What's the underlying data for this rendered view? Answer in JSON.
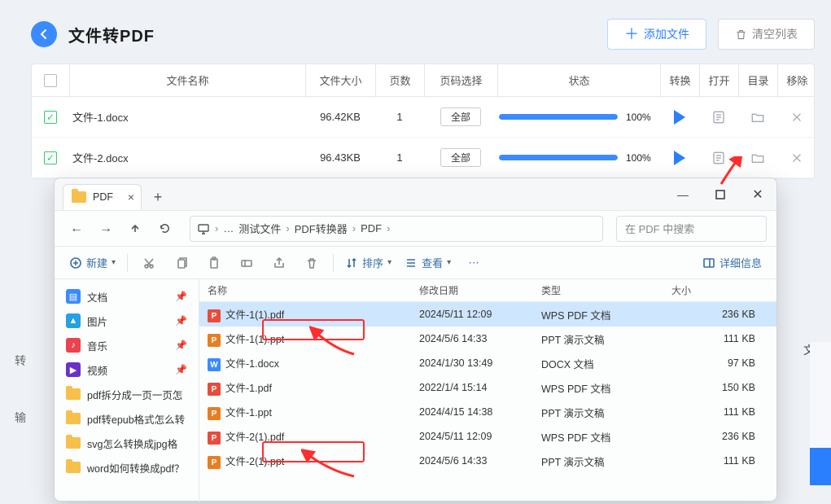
{
  "app": {
    "title": "文件转PDF",
    "add_btn": "添加文件",
    "clear_btn": "清空列表",
    "columns": {
      "name": "文件名称",
      "size": "文件大小",
      "pages": "页数",
      "page_sel": "页码选择",
      "status": "状态",
      "convert": "转换",
      "open": "打开",
      "dir": "目录",
      "remove": "移除"
    },
    "rows": [
      {
        "name": "文件-1.docx",
        "size": "96.42KB",
        "pages": "1",
        "page_sel": "全部",
        "pct": "100%",
        "progress": 100
      },
      {
        "name": "文件-2.docx",
        "size": "96.43KB",
        "pages": "1",
        "page_sel": "全部",
        "pct": "100%",
        "progress": 100
      }
    ]
  },
  "side_labels": {
    "col1": "文件",
    "col2": "转",
    "col3": "输"
  },
  "explorer": {
    "tab_title": "PDF",
    "breadcrumbs": [
      "测试文件",
      "PDF转换器",
      "PDF"
    ],
    "ellipsis": "…",
    "search_placeholder": "在 PDF 中搜索",
    "tool_new": "新建",
    "tool_sort": "排序",
    "tool_view": "查看",
    "tool_details": "详细信息",
    "sidebar": [
      {
        "icon": "doc",
        "color": "#3a8bff",
        "label": "文档",
        "pinned": true
      },
      {
        "icon": "pic",
        "color": "#24a2e3",
        "label": "图片",
        "pinned": true
      },
      {
        "icon": "mus",
        "color": "#e9434d",
        "label": "音乐",
        "pinned": true
      },
      {
        "icon": "vid",
        "color": "#6a30c9",
        "label": "视频",
        "pinned": true
      },
      {
        "icon": "fld",
        "label": "pdf拆分成一页一页怎"
      },
      {
        "icon": "fld",
        "label": "pdf转epub格式怎么转"
      },
      {
        "icon": "fld",
        "label": "svg怎么转换成jpg格"
      },
      {
        "icon": "fld",
        "label": "word如何转换成pdf？"
      }
    ],
    "columns": {
      "name": "名称",
      "date": "修改日期",
      "type": "类型",
      "size": "大小"
    },
    "files": [
      {
        "icon": "pdf",
        "name": "文件-1(1).pdf",
        "date": "2024/5/11 12:09",
        "type": "WPS PDF 文档",
        "size": "236 KB",
        "selected": true
      },
      {
        "icon": "ppt",
        "name": "文件-1(1).ppt",
        "date": "2024/5/6 14:33",
        "type": "PPT 演示文稿",
        "size": "111 KB"
      },
      {
        "icon": "doc",
        "name": "文件-1.docx",
        "date": "2024/1/30 13:49",
        "type": "DOCX 文档",
        "size": "97 KB"
      },
      {
        "icon": "pdf",
        "name": "文件-1.pdf",
        "date": "2022/1/4 15:14",
        "type": "WPS PDF 文档",
        "size": "150 KB"
      },
      {
        "icon": "ppt",
        "name": "文件-1.ppt",
        "date": "2024/4/15 14:38",
        "type": "PPT 演示文稿",
        "size": "111 KB"
      },
      {
        "icon": "pdf",
        "name": "文件-2(1).pdf",
        "date": "2024/5/11 12:09",
        "type": "WPS PDF 文档",
        "size": "236 KB"
      },
      {
        "icon": "ppt",
        "name": "文件-2(1).ppt",
        "date": "2024/5/6 14:33",
        "type": "PPT 演示文稿",
        "size": "111 KB"
      }
    ]
  }
}
